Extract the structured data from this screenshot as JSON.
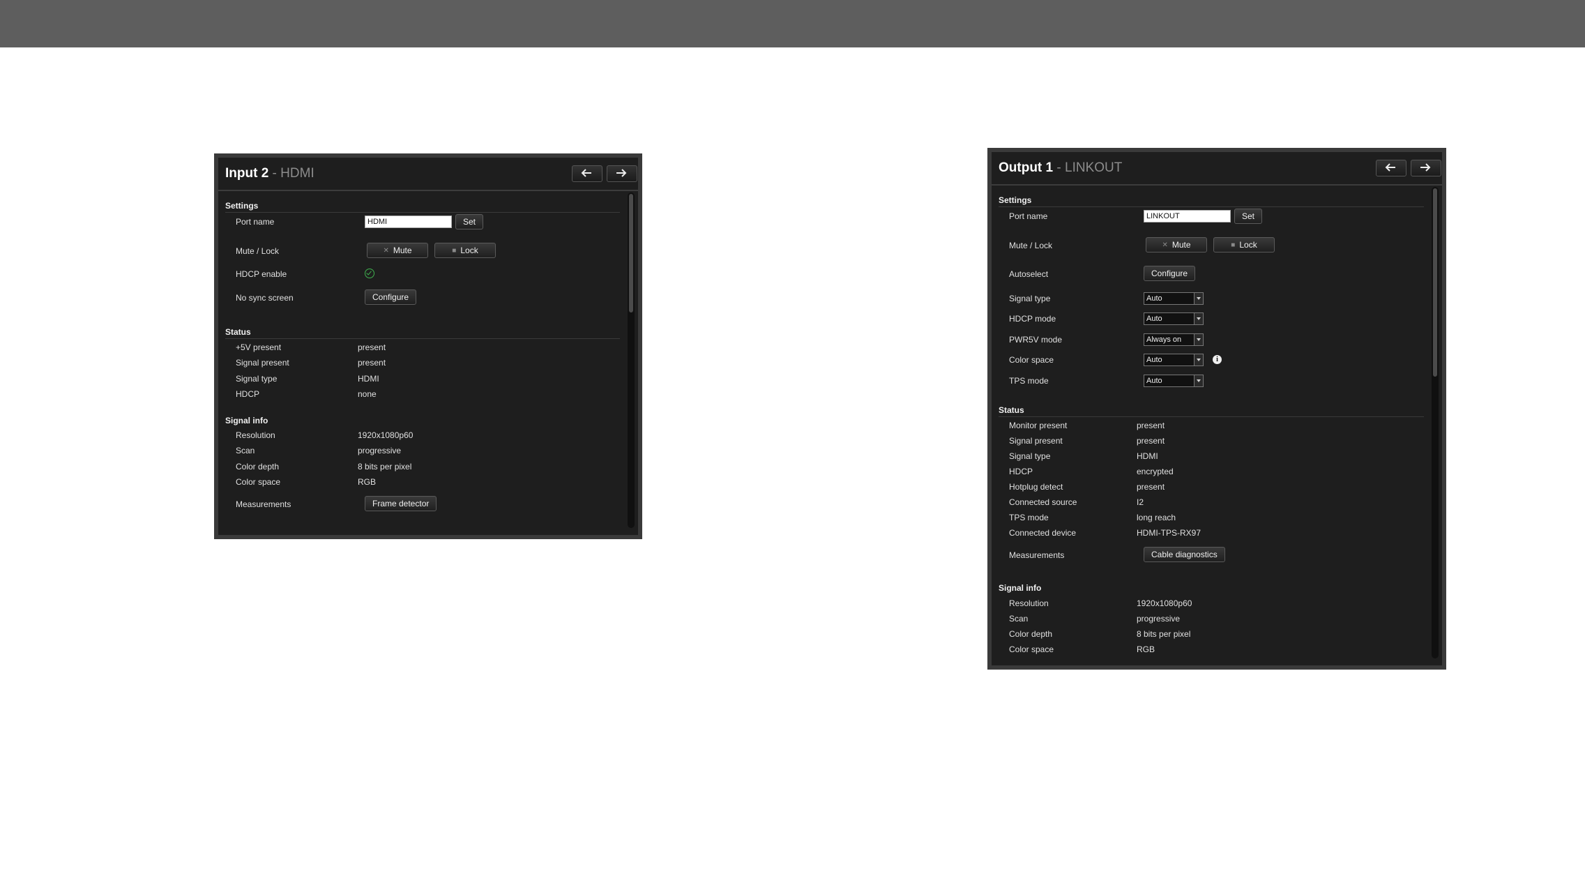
{
  "input_panel": {
    "title": "Input 2",
    "separator": " - ",
    "subtitle": "HDMI",
    "nav": {
      "prev_icon": "arrow-left-icon",
      "next_icon": "arrow-right-icon"
    },
    "settings": {
      "heading": "Settings",
      "port_name_label": "Port name",
      "port_name_value": "HDMI",
      "set_label": "Set",
      "mute_lock_label": "Mute / Lock",
      "mute_label": "Mute",
      "lock_label": "Lock",
      "hdcp_enable_label": "HDCP enable",
      "hdcp_enable_checked": true,
      "no_sync_label": "No sync screen",
      "configure_label": "Configure"
    },
    "status": {
      "heading": "Status",
      "rows": [
        {
          "label": "+5V present",
          "value": "present"
        },
        {
          "label": "Signal present",
          "value": "present"
        },
        {
          "label": "Signal type",
          "value": "HDMI"
        },
        {
          "label": "HDCP",
          "value": "none"
        }
      ]
    },
    "signal_info": {
      "heading": "Signal info",
      "rows": [
        {
          "label": "Resolution",
          "value": "1920x1080p60"
        },
        {
          "label": "Scan",
          "value": "progressive"
        },
        {
          "label": "Color depth",
          "value": "8 bits per pixel"
        },
        {
          "label": "Color space",
          "value": "RGB"
        }
      ],
      "measurements_label": "Measurements",
      "frame_detector_label": "Frame detector"
    }
  },
  "output_panel": {
    "title": "Output 1",
    "separator": " - ",
    "subtitle": "LINKOUT",
    "nav": {
      "prev_icon": "arrow-left-icon",
      "next_icon": "arrow-right-icon"
    },
    "settings": {
      "heading": "Settings",
      "port_name_label": "Port name",
      "port_name_value": "LINKOUT",
      "set_label": "Set",
      "mute_lock_label": "Mute / Lock",
      "mute_label": "Mute",
      "lock_label": "Lock",
      "autoselect_label": "Autoselect",
      "configure_label": "Configure",
      "dropdowns": [
        {
          "label": "Signal type",
          "value": "Auto"
        },
        {
          "label": "HDCP mode",
          "value": "Auto"
        },
        {
          "label": "PWR5V mode",
          "value": "Always on"
        },
        {
          "label": "Color space",
          "value": "Auto"
        },
        {
          "label": "TPS mode",
          "value": "Auto"
        }
      ],
      "info_glyph": "i"
    },
    "status": {
      "heading": "Status",
      "rows": [
        {
          "label": "Monitor present",
          "value": "present"
        },
        {
          "label": "Signal present",
          "value": "present"
        },
        {
          "label": "Signal type",
          "value": "HDMI"
        },
        {
          "label": "HDCP",
          "value": "encrypted"
        },
        {
          "label": "Hotplug detect",
          "value": "present"
        },
        {
          "label": "Connected source",
          "value": "I2"
        },
        {
          "label": "TPS mode",
          "value": "long reach"
        },
        {
          "label": "Connected device",
          "value": "HDMI-TPS-RX97"
        }
      ],
      "measurements_label": "Measurements",
      "cable_diag_label": "Cable diagnostics"
    },
    "signal_info": {
      "heading": "Signal info",
      "rows": [
        {
          "label": "Resolution",
          "value": "1920x1080p60"
        },
        {
          "label": "Scan",
          "value": "progressive"
        },
        {
          "label": "Color depth",
          "value": "8 bits per pixel"
        },
        {
          "label": "Color space",
          "value": "RGB"
        }
      ]
    }
  },
  "colors": {
    "panel_bg": "#1e1e1e",
    "top_bar": "#5e5e5e",
    "check_green": "#3fb24f"
  }
}
